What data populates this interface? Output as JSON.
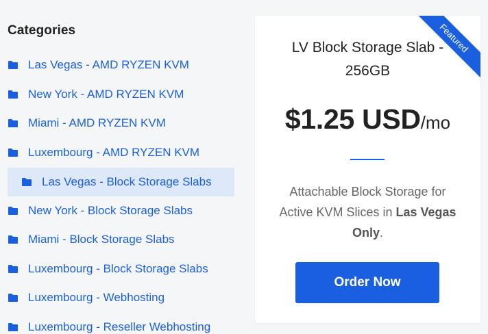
{
  "sidebar": {
    "title": "Categories",
    "items": [
      {
        "label": "Las Vegas - AMD RYZEN KVM",
        "active": false
      },
      {
        "label": "New York - AMD RYZEN KVM",
        "active": false
      },
      {
        "label": "Miami - AMD RYZEN KVM",
        "active": false
      },
      {
        "label": "Luxembourg - AMD RYZEN KVM",
        "active": false
      },
      {
        "label": "Las Vegas - Block Storage Slabs",
        "active": true
      },
      {
        "label": "New York - Block Storage Slabs",
        "active": false
      },
      {
        "label": "Miami - Block Storage Slabs",
        "active": false
      },
      {
        "label": "Luxembourg - Block Storage Slabs",
        "active": false
      },
      {
        "label": "Luxembourg - Webhosting",
        "active": false
      },
      {
        "label": "Luxembourg - Reseller Webhosting",
        "active": false
      }
    ],
    "item_icon": "folder-icon"
  },
  "product": {
    "ribbon": "Featured",
    "title": "LV Block Storage Slab - 256GB",
    "price": "$1.25 USD",
    "cycle": "/mo",
    "desc_before": "Attachable Block Storage for Active KVM Slices in ",
    "desc_bold": "Las Vegas Only",
    "desc_after": ".",
    "order_label": "Order Now"
  },
  "colors": {
    "accent": "#1a5fe0",
    "active_bg": "#dde8f8",
    "page_bg": "#f5f6f8"
  }
}
